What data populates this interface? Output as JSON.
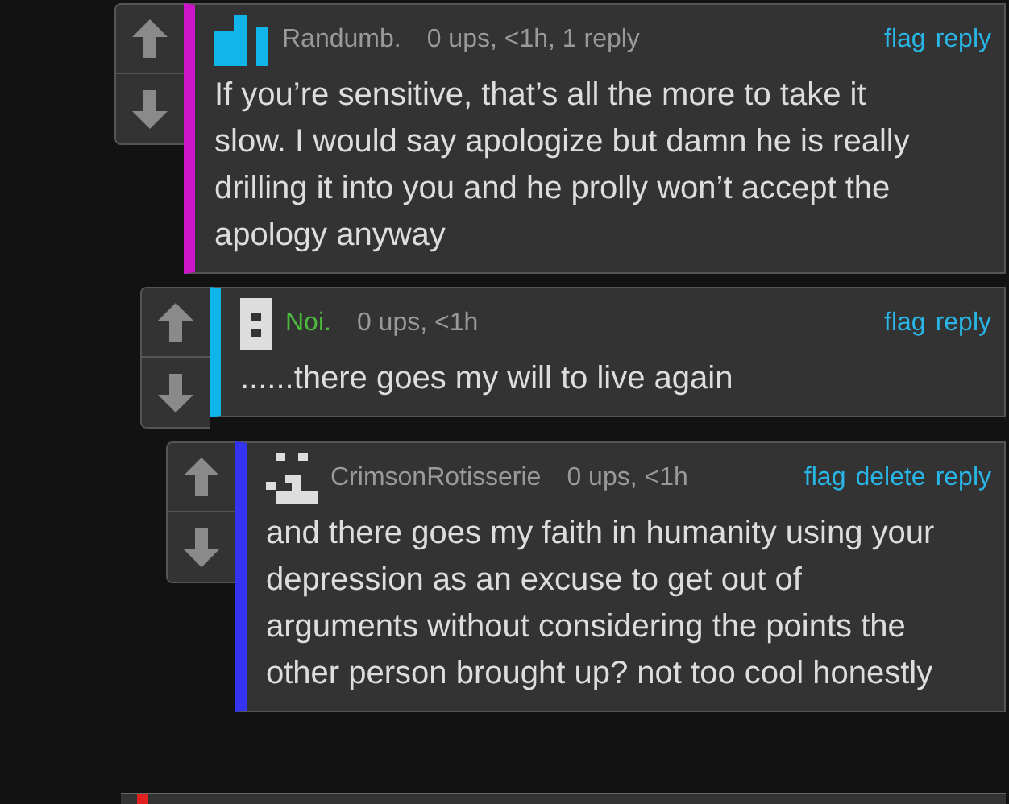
{
  "comments": [
    {
      "author": {
        "name": "Randumb.",
        "color": "#9a9a9a"
      },
      "avatar": {
        "kind": "bars"
      },
      "color": "#cc14c8",
      "meta": "0 ups, <1h, 1 reply",
      "actions": [
        "flag",
        "reply"
      ],
      "text": "If you’re sensitive, that’s all the more to take it slow. I would say apologize but damn he is really drilling it into you and he prolly won’t accept the apology anyway",
      "children": [
        {
          "author": {
            "name": "Noi.",
            "color": "#4cbb3c"
          },
          "avatar": {
            "kind": "dots"
          },
          "color": "#0fb4ea",
          "meta": "0 ups, <1h",
          "actions": [
            "flag",
            "reply"
          ],
          "text": "......there goes my will to live again",
          "children": [
            {
              "author": {
                "name": "CrimsonRotisserie",
                "color": "#9a9a9a"
              },
              "avatar": {
                "kind": "pixels"
              },
              "color": "#3434f0",
              "meta": "0 ups, <1h",
              "actions": [
                "flag",
                "delete",
                "reply"
              ],
              "text": "and there goes my faith in humanity using your depression as an excuse to get out of arguments without considering the points the other person brought up? not too cool honestly"
            }
          ]
        }
      ]
    }
  ]
}
